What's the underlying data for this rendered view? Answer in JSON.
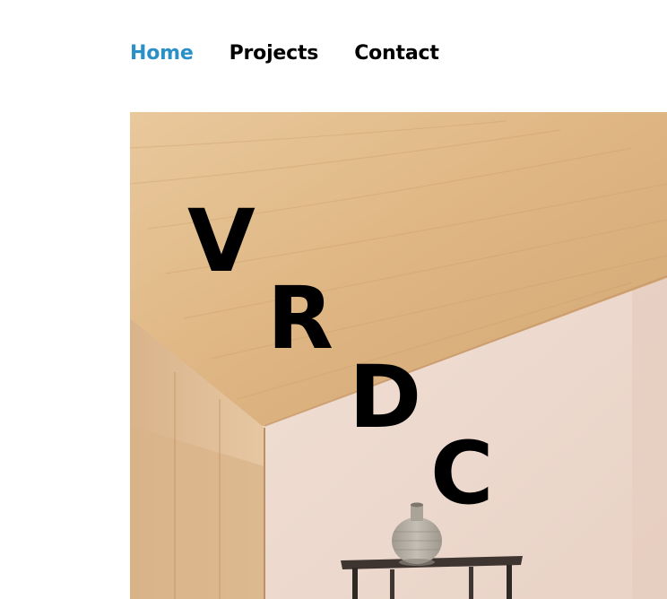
{
  "nav": {
    "items": [
      {
        "label": "Home",
        "active": true
      },
      {
        "label": "Projects",
        "active": false
      },
      {
        "label": "Contact",
        "active": false
      }
    ]
  },
  "hero": {
    "logo_letters": [
      "V",
      "R",
      "D",
      "C"
    ]
  },
  "colors": {
    "nav_active": "#2b8fc8",
    "nav_default": "#000000",
    "background": "#ffffff"
  }
}
